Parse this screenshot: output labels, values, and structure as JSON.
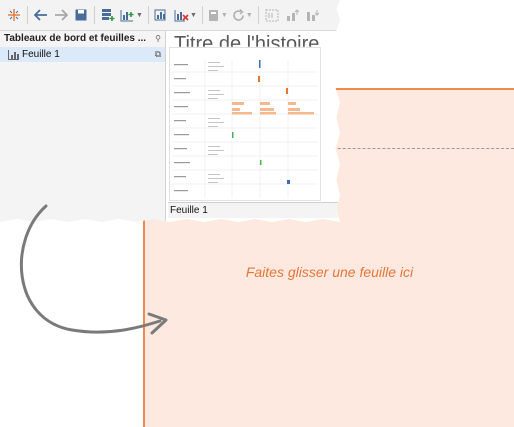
{
  "toolbar": {
    "buttons": [
      {
        "icon": "tableau-logo-icon"
      },
      {
        "icon": "back-arrow-icon"
      },
      {
        "icon": "forward-arrow-icon"
      },
      {
        "icon": "save-icon"
      },
      {
        "icon": "new-data-source-icon"
      },
      {
        "icon": "new-worksheet-icon"
      },
      {
        "icon": "duplicate-sheet-icon"
      },
      {
        "icon": "clear-sheet-icon"
      },
      {
        "icon": "pause-updates-icon"
      },
      {
        "icon": "refresh-icon"
      },
      {
        "icon": "swap-icon"
      },
      {
        "icon": "sort-ascending-icon"
      },
      {
        "icon": "sort-descending-icon"
      }
    ]
  },
  "sidebar": {
    "header": "Tableaux de bord et feuilles ...",
    "pin_icon": "pin-icon",
    "items": [
      {
        "label": "Feuille 1",
        "icon": "bar-chart-icon",
        "action_icon": "external-link-icon"
      }
    ]
  },
  "canvas": {
    "title": "Titre de l'histoire",
    "thumbnail_label": "Feuille 1"
  },
  "dropzone": {
    "text": "Faites glisser une feuille ici"
  },
  "colors": {
    "drop_fill": "#fde9df",
    "drop_border": "#ef8a4f",
    "drop_text": "#e6763a",
    "selection": "#dbe9f8"
  }
}
